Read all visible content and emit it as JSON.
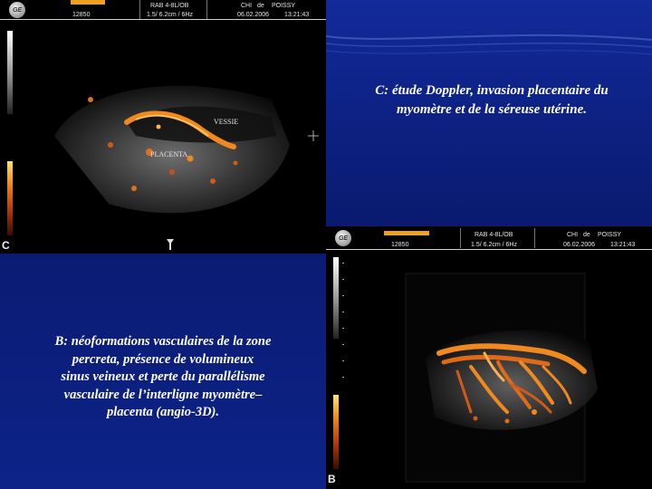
{
  "panel_c": {
    "header": {
      "logo": "GE",
      "gain": "12850",
      "probe": "RAB 4-8L/OB",
      "depth_freq": "1.5/ 6.2cm / 6Hz",
      "institution_a": "CHI",
      "institution_b": "de",
      "institution_c": "POISSY",
      "date": "06.02.2006",
      "time": "13:21:43"
    },
    "labels": {
      "vessie": "VESSIE",
      "placenta": "PLACENTA"
    },
    "panel_letter": "C"
  },
  "panel_b": {
    "header": {
      "logo": "GE",
      "gain": "12850",
      "probe": "RAB 4-8L/OB",
      "depth_freq": "1.5/ 6.2cm / 6Hz",
      "institution_a": "CHI",
      "institution_b": "de",
      "institution_c": "POISSY",
      "date": "06.02.2006",
      "time": "13:21:43"
    },
    "panel_letter": "B"
  },
  "captions": {
    "c": "C: étude Doppler, invasion placentaire du\nmyomètre et de la séreuse utérine.",
    "b": "B: néoformations vasculaires de la zone\npercreta, présence de volumineux\nsinus veineux et perte du parallélisme\nvasculaire de l’interligne myomètre–\nplacenta (angio-3D)."
  },
  "colors": {
    "background": "#0b1f7a",
    "doppler_orange": "#f08a20",
    "header_bar": "#f0a020",
    "text": "#ffffff"
  }
}
